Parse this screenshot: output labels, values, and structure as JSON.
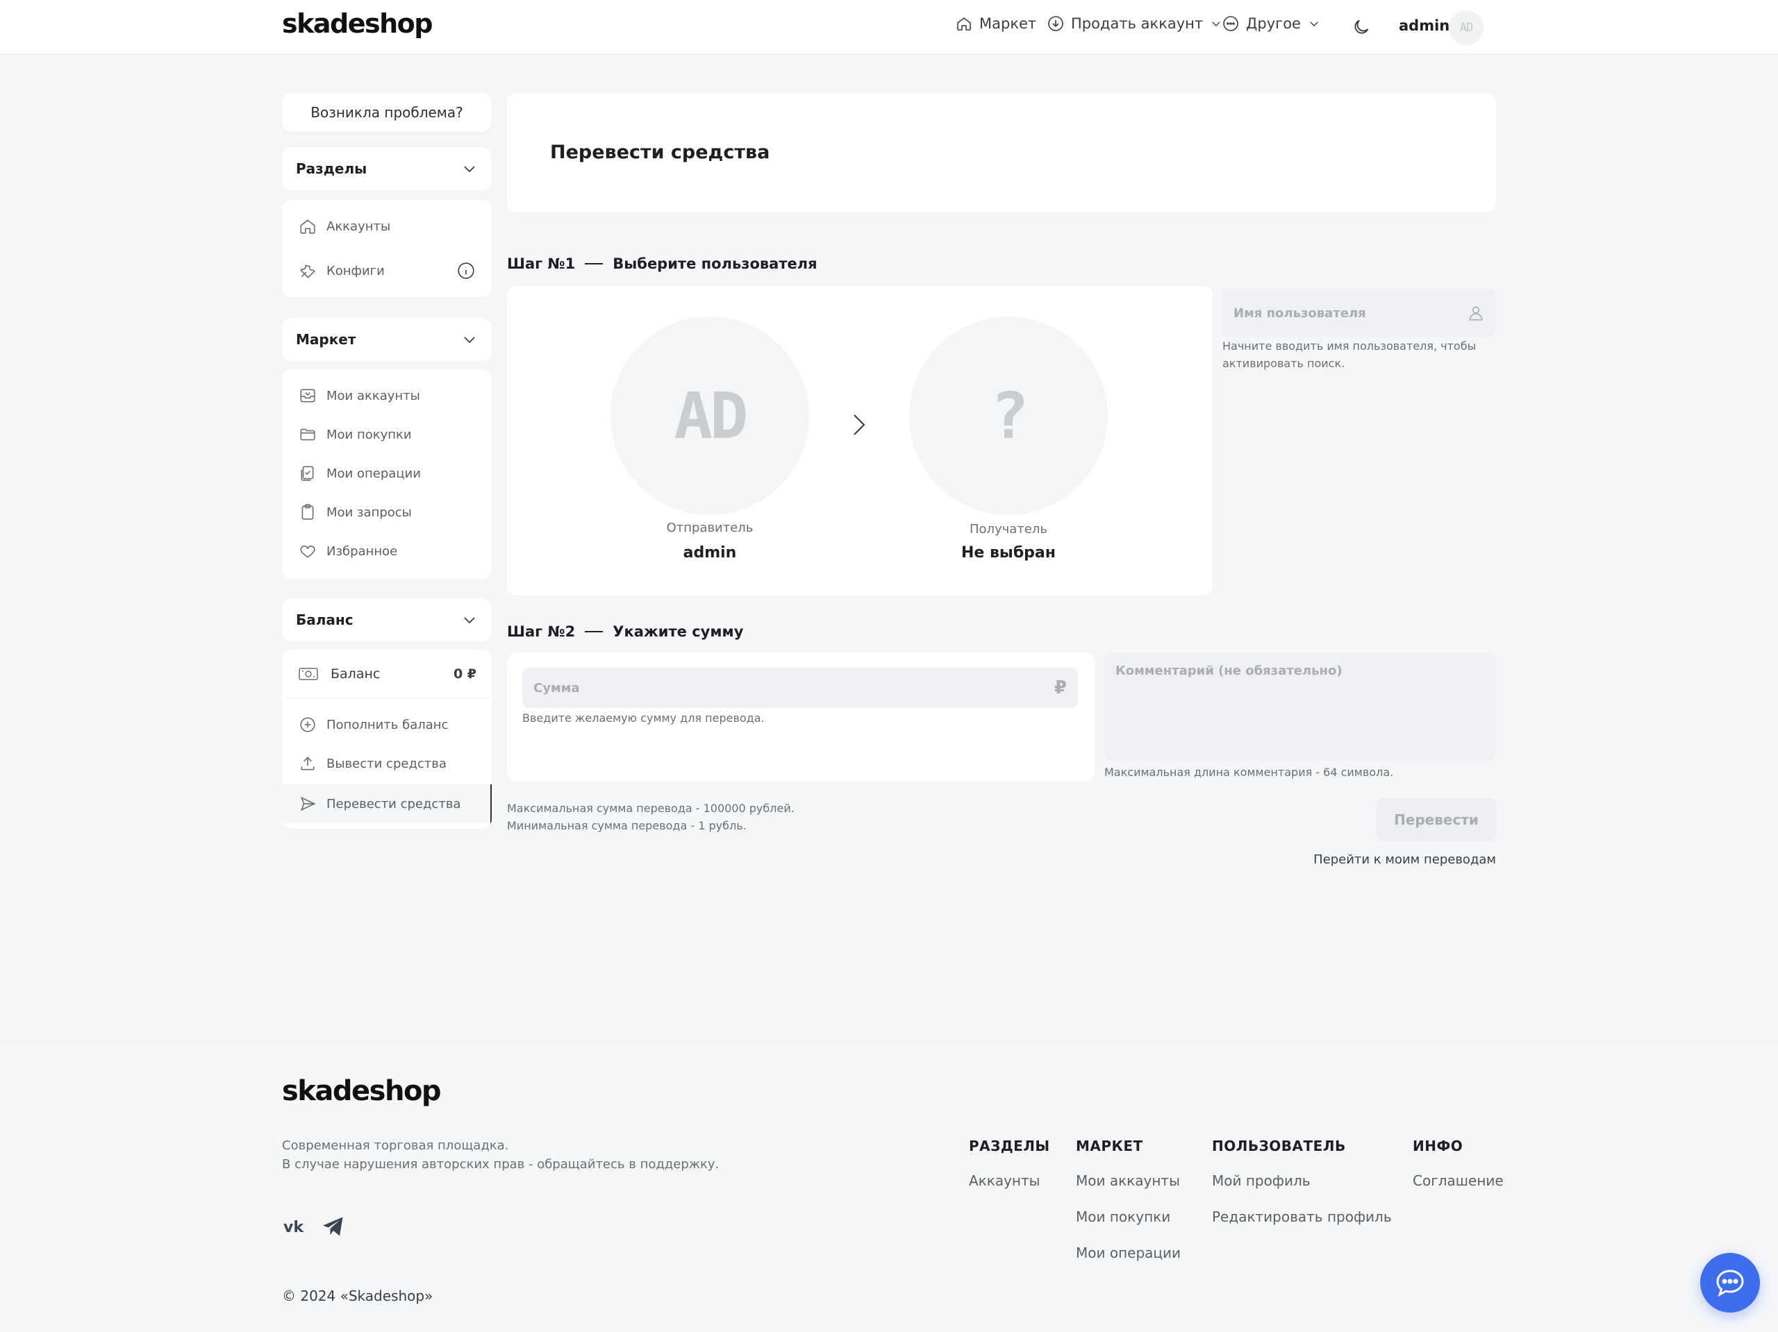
{
  "header": {
    "logo": "skadeshop",
    "nav": [
      {
        "label": "Маркет",
        "icon": "home-icon"
      },
      {
        "label": "Продать аккаунт",
        "icon": "download-icon"
      },
      {
        "label": "Другое",
        "icon": "more-icon"
      }
    ],
    "user_name": "admin",
    "user_avatar": "AD"
  },
  "sidebar": {
    "problem_button": "Возникла проблема?",
    "sections": {
      "title": "Разделы",
      "items": [
        {
          "label": "Аккаунты",
          "icon": "home-icon"
        },
        {
          "label": "Конфиги",
          "icon": "wrench-icon"
        }
      ]
    },
    "market": {
      "title": "Маркет",
      "items": [
        {
          "label": "Мои аккаунты",
          "icon": "inbox-icon"
        },
        {
          "label": "Мои покупки",
          "icon": "folder-icon"
        },
        {
          "label": "Мои операции",
          "icon": "clipboard-check-icon"
        },
        {
          "label": "Мои запросы",
          "icon": "clipboard-icon"
        },
        {
          "label": "Избранное",
          "icon": "heart-icon"
        }
      ]
    },
    "balance": {
      "title": "Баланс",
      "balance_label": "Баланс",
      "balance_value": "0 ₽",
      "items": [
        {
          "label": "Пополнить баланс",
          "icon": "plus-circle-icon"
        },
        {
          "label": "Вывести средства",
          "icon": "upload-icon"
        },
        {
          "label": "Перевести средства",
          "icon": "send-icon"
        }
      ]
    }
  },
  "main": {
    "title": "Перевести средства",
    "step1": {
      "number": "Шаг №1",
      "label": "Выберите пользователя",
      "sender_avatar": "AD",
      "sender_role": "Отправитель",
      "sender_name": "admin",
      "receiver_avatar": "?",
      "receiver_role": "Получатель",
      "receiver_name": "Не выбран",
      "username_placeholder": "Имя пользователя",
      "username_hint_1": "Начните вводить имя пользователя, чтобы",
      "username_hint_2": "активировать поиск."
    },
    "step2": {
      "number": "Шаг №2",
      "label": "Укажите сумму",
      "amount_placeholder": "Сумма",
      "amount_hint": "Введите желаемую сумму для перевода.",
      "comment_placeholder": "Комментарий (не обязательно)",
      "comment_hint": "Максимальная длина комментария - 64 символа.",
      "limit_max": "Максимальная сумма перевода - 100000 рублей.",
      "limit_min": "Минимальная сумма перевода - 1 рубль.",
      "submit": "Перевести",
      "transfers_link": "Перейти к моим переводам"
    }
  },
  "footer": {
    "logo": "skadeshop",
    "desc_1": "Современная торговая площадка.",
    "desc_2": "В случае нарушения авторских прав - обращайтесь в поддержку.",
    "copyright": "© 2024 «Skadeshop»",
    "columns": [
      {
        "title": "РАЗДЕЛЫ",
        "links": [
          "Аккаунты"
        ]
      },
      {
        "title": "МАРКЕТ",
        "links": [
          "Мои аккаунты",
          "Мои покупки",
          "Мои операции"
        ]
      },
      {
        "title": "ПОЛЬЗОВАТЕЛЬ",
        "links": [
          "Мой профиль",
          "Редактировать профиль"
        ]
      },
      {
        "title": "ИНФО",
        "links": [
          "Соглашение"
        ]
      }
    ]
  },
  "colors": {
    "accent": "#3e6ef0",
    "background": "#f5f6f8",
    "card": "#ffffff"
  }
}
